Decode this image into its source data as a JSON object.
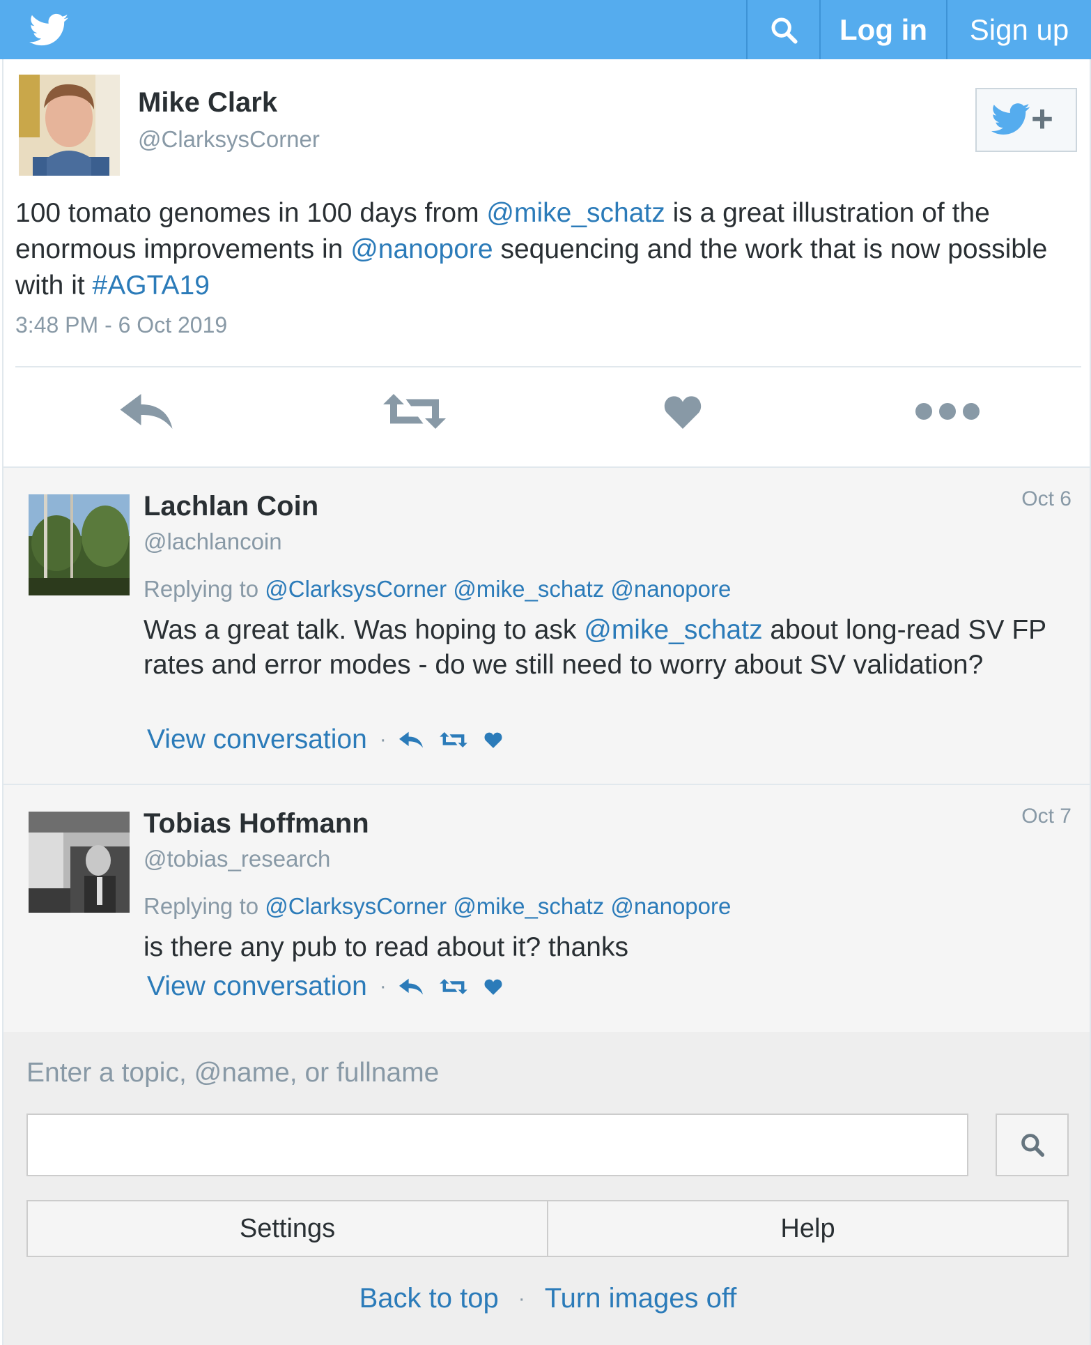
{
  "topbar": {
    "login_label": "Log in",
    "signup_label": "Sign up",
    "logo_icon": "twitter-bird-icon",
    "search_icon": "search-icon",
    "color": "#55acee"
  },
  "main_tweet": {
    "name": "Mike Clark",
    "handle": "@ClarksysCorner",
    "text_parts": {
      "p1": "100 tomato genomes in 100 days from ",
      "mention1": "@mike_schatz",
      "p2": " is a great illustration of the enormous improvements in ",
      "mention2": "@nanopore",
      "p3": " sequencing and the work that is now possible with it ",
      "hashtag": "#AGTA19"
    },
    "timestamp": "3:48 PM - 6 Oct 2019",
    "actions": [
      "reply-icon",
      "retweet-icon",
      "like-icon",
      "more-icon"
    ]
  },
  "replies": [
    {
      "name": "Lachlan Coin",
      "handle": "@lachlancoin",
      "date": "Oct 6",
      "replying_prefix": "Replying to ",
      "replying_to": [
        "@ClarksysCorner",
        "@mike_schatz",
        "@nanopore"
      ],
      "text_parts": {
        "p1": "Was a great talk. Was hoping to ask ",
        "mention": "@mike_schatz",
        "p2": " about long-read SV FP rates and error modes - do we still need to worry about SV validation?"
      },
      "view_label": "View conversation"
    },
    {
      "name": "Tobias Hoffmann",
      "handle": "@tobias_research",
      "date": "Oct 7",
      "replying_prefix": "Replying to ",
      "replying_to": [
        "@ClarksysCorner",
        "@mike_schatz",
        "@nanopore"
      ],
      "text": "is there any pub to read about it? thanks",
      "view_label": "View conversation"
    }
  ],
  "search": {
    "label": "Enter a topic, @name, or fullname",
    "value": "",
    "placeholder": ""
  },
  "buttons": {
    "settings": "Settings",
    "help": "Help"
  },
  "footer": {
    "back_to_top": "Back to top",
    "separator": "·",
    "turn_images_off": "Turn images off"
  },
  "colors": {
    "link": "#2b7bb9",
    "muted": "#8899a6",
    "action_icon": "#8899a6",
    "mini_action_icon": "#2b7bb9"
  }
}
